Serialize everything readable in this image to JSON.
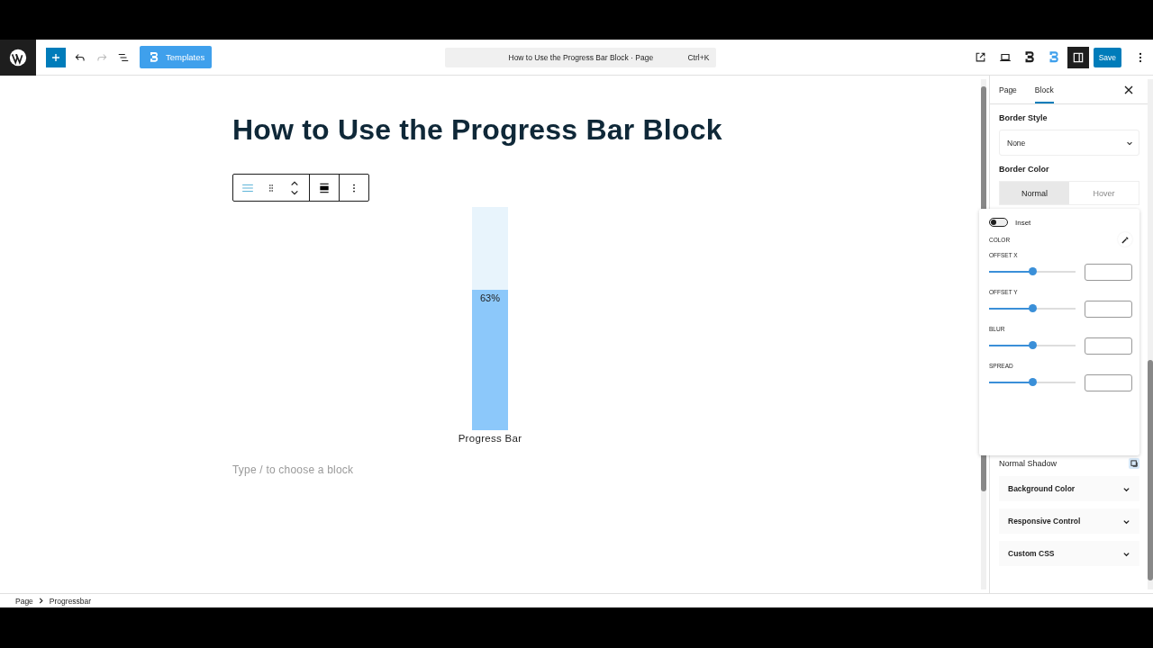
{
  "toolbar": {
    "templates_button": "Templates",
    "document_title": "How to Use the Progress Bar Block · Page",
    "shortcut": "Ctrl+K",
    "save_button": "Save"
  },
  "page_title": "How to Use the Progress Bar Block",
  "progress_bar": {
    "level": 0.63,
    "value_label": "63%",
    "caption": "Progress Bar"
  },
  "block_placeholder": "Type / to choose a block",
  "sidebar": {
    "tabs": [
      {
        "label": "Page",
        "selected": false
      },
      {
        "label": "Block",
        "selected": true
      }
    ],
    "border_style": {
      "label": "Border Style",
      "value": "None"
    },
    "border_color": {
      "label": "Border Color",
      "states": [
        {
          "label": "Normal",
          "selected": true
        },
        {
          "label": "Hover",
          "selected": false
        }
      ]
    },
    "shadow_label": "Normal Shadow",
    "sections": [
      "Background Color",
      "Responsive Control",
      "Custom CSS"
    ]
  },
  "shadow_popover": {
    "inset": {
      "label": "Inset",
      "on": false
    },
    "color_label": "COLOR",
    "sliders": [
      {
        "label": "OFFSET X",
        "level": 0.5
      },
      {
        "label": "OFFSET Y",
        "level": 0.5
      },
      {
        "label": "BLUR",
        "level": 0.5
      },
      {
        "label": "SPREAD",
        "level": 0.5
      }
    ]
  },
  "breadcrumb": [
    "Page",
    "Progressbar"
  ]
}
